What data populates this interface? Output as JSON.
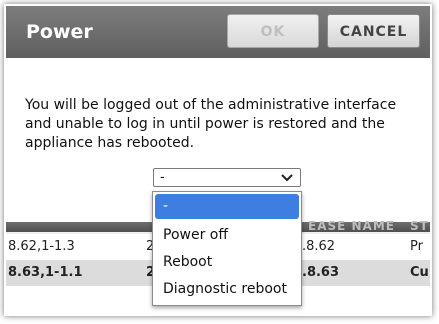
{
  "dialog": {
    "title": "Power",
    "ok_label": "OK",
    "cancel_label": "CANCEL",
    "message": "You will be logged out of the administrative interface and unable to log in until power is restored and the appliance has rebooted."
  },
  "select": {
    "value": "-",
    "options": [
      "-",
      "Power off",
      "Reboot",
      "Diagnostic reboot"
    ],
    "selected_index": 0
  },
  "background_table": {
    "header_fragment_1": "EASE NAME",
    "header_fragment_2": "ST",
    "rows": [
      {
        "c1": "8.62,1-1.3",
        "c2": "2",
        "c3": ".8.62",
        "c4": "Pr"
      },
      {
        "c1": "8.63,1-1.1",
        "c2": "2",
        "c3": ".8.63",
        "c4": "Cu"
      }
    ]
  },
  "colors": {
    "title_bar": "#6e6e6e",
    "option_highlight": "#3d7ee0"
  }
}
